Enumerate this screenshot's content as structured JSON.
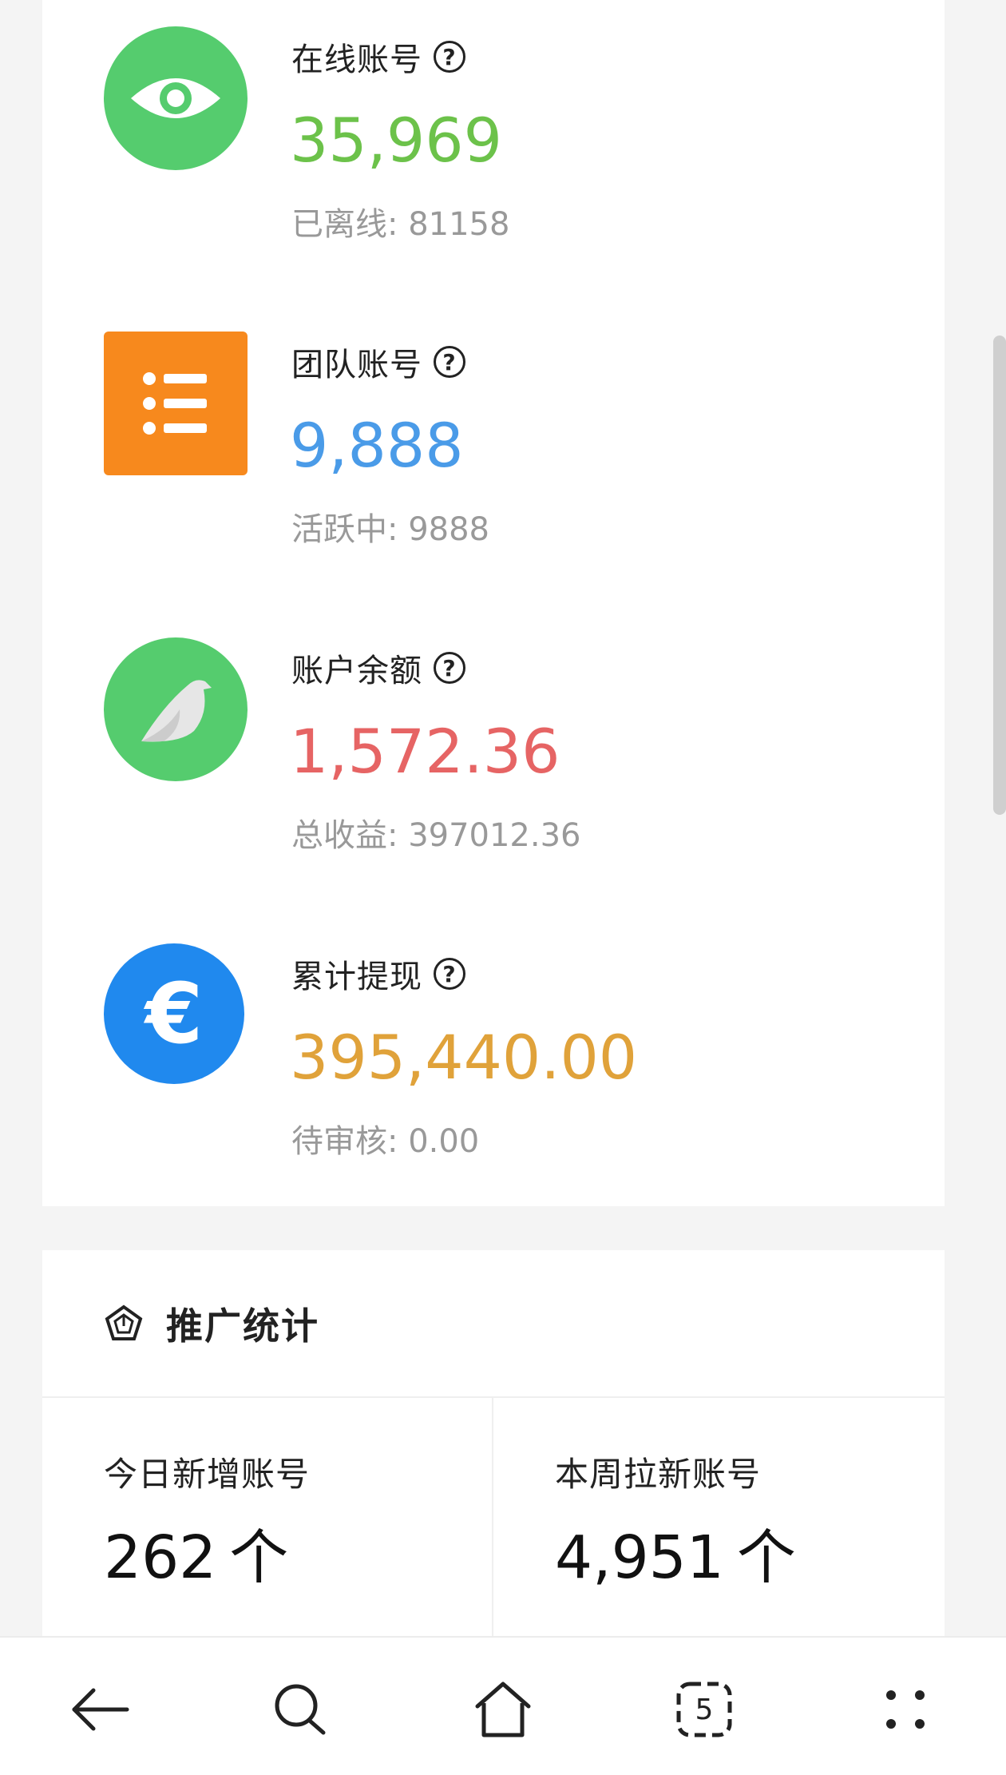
{
  "stats": [
    {
      "label": "在线账号",
      "value": "35,969",
      "sub": "已离线: 81158",
      "icon": "eye-icon",
      "value_color": "#6cc24a",
      "icon_bg": "#55cc6e"
    },
    {
      "label": "团队账号",
      "value": "9,888",
      "sub": "活跃中: 9888",
      "icon": "list-icon",
      "value_color": "#4a9be8",
      "icon_bg": "#f7891d"
    },
    {
      "label": "账户余额",
      "value": "1,572.36",
      "sub": "总收益: 397012.36",
      "icon": "bird-icon",
      "value_color": "#e66464",
      "icon_bg": "#55cc6e"
    },
    {
      "label": "累计提现",
      "value": "395,440.00",
      "sub": "待审核: 0.00",
      "icon": "euro-icon",
      "value_color": "#e0a23a",
      "icon_bg": "#2089ee"
    }
  ],
  "promo": {
    "title": "推广统计",
    "items": [
      {
        "label": "今日新增账号",
        "value": "262",
        "unit": "个"
      },
      {
        "label": "本周拉新账号",
        "value": "4,951",
        "unit": "个"
      }
    ]
  },
  "nav": {
    "tab_count": "5",
    "icons": [
      "back-arrow-icon",
      "search-icon",
      "home-icon",
      "tabs-icon",
      "menu-dots-icon"
    ]
  }
}
